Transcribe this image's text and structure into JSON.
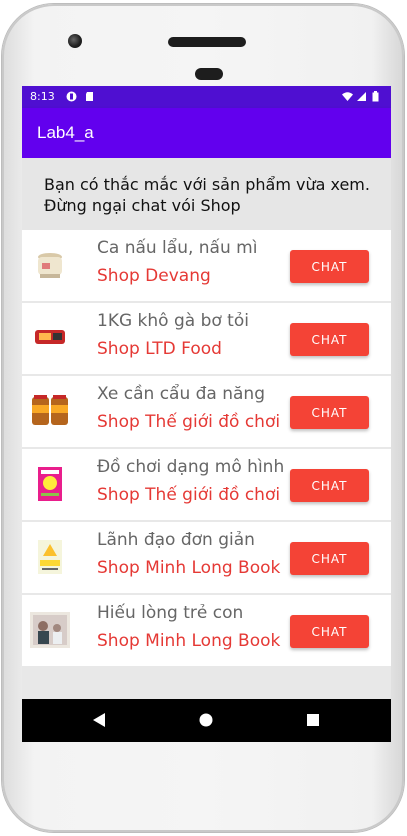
{
  "status_bar": {
    "time": "8:13"
  },
  "app_bar": {
    "title": "Lab4_a"
  },
  "notice": {
    "line1": "Bạn có thắc mắc với sản phẩm vừa xem.",
    "line2": "Đừng ngại chat vói Shop"
  },
  "items": [
    {
      "product": "Ca nấu lẩu, nấu mì",
      "shop": "Shop Devang",
      "button": "CHAT"
    },
    {
      "product": "1KG khô gà bơ tỏi",
      "shop": "Shop LTD Food",
      "button": "CHAT"
    },
    {
      "product": "Xe cần cẩu đa năng",
      "shop": "Shop Thế giới đồ chơi",
      "button": "CHAT"
    },
    {
      "product": "Đồ chơi dạng mô hình",
      "shop": "Shop Thế giới đồ chơi",
      "button": "CHAT"
    },
    {
      "product": "Lãnh đạo đơn giản",
      "shop": "Shop Minh Long Book",
      "button": "CHAT"
    },
    {
      "product": "Hiếu lòng trẻ con",
      "shop": "Shop Minh Long Book",
      "button": "CHAT"
    }
  ],
  "colors": {
    "status_bar": "#4f0fd1",
    "app_bar": "#6200ee",
    "chat_button": "#f44336",
    "shop_text": "#e53935"
  }
}
